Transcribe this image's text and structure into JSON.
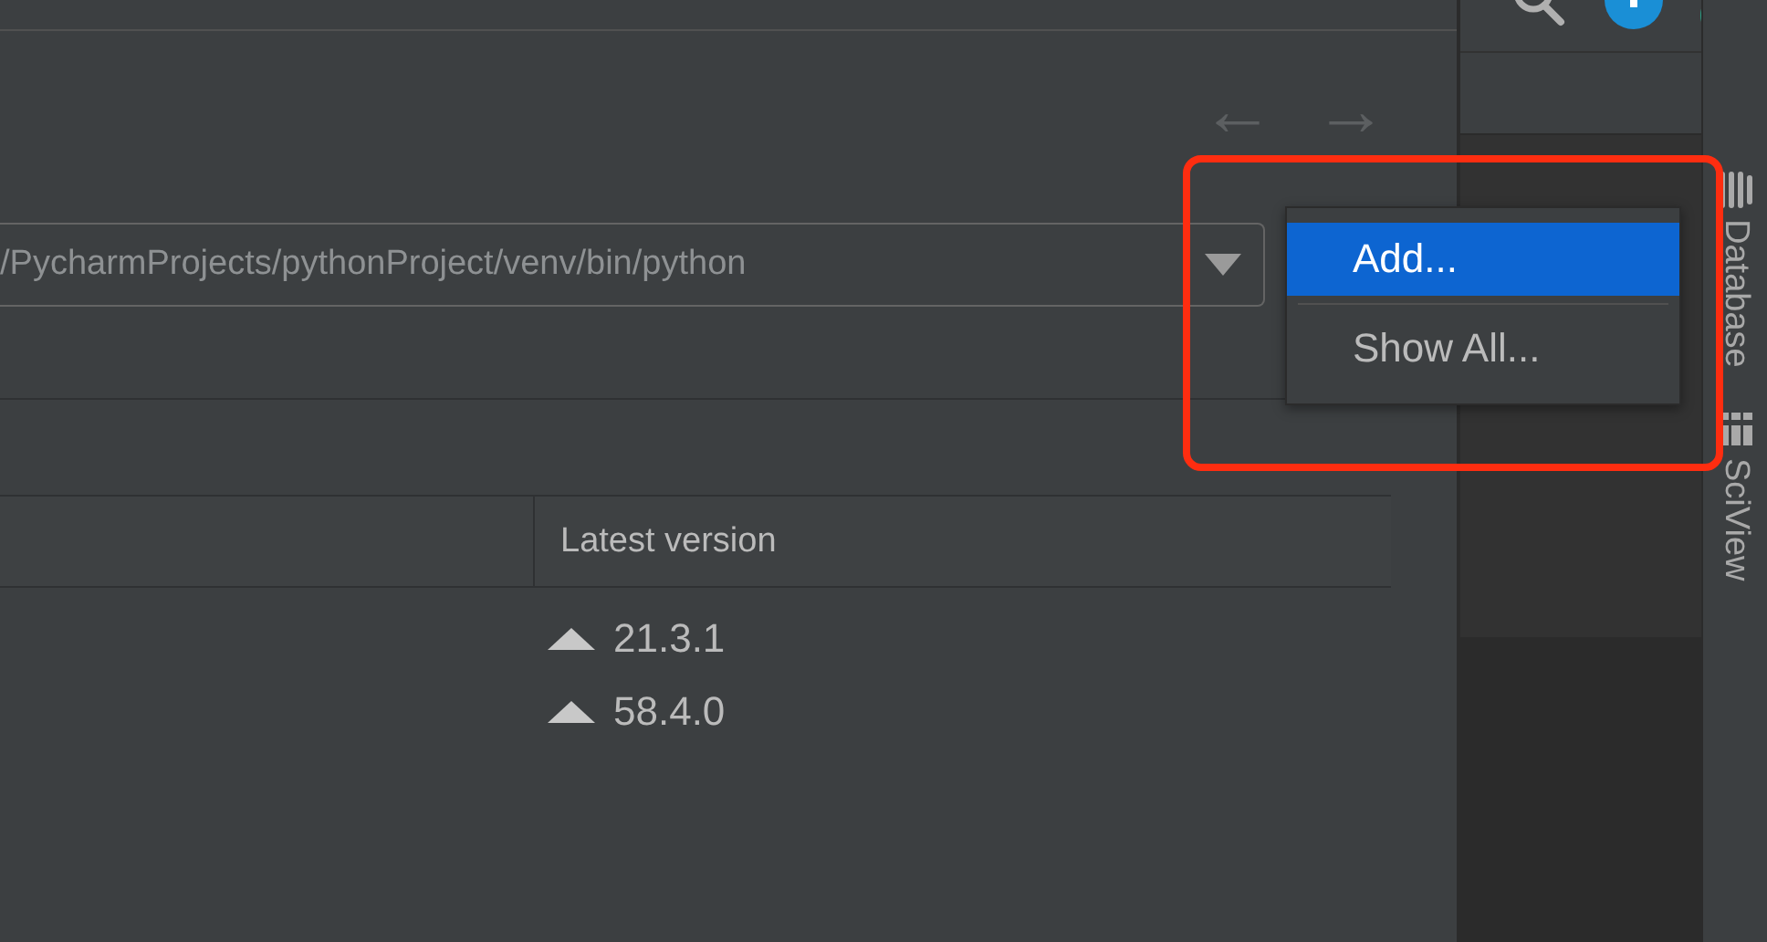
{
  "navigation": [
    {
      "symbol": "←",
      "disabled": true
    },
    {
      "symbol": "→",
      "disabled": true
    }
  ],
  "interpreter": {
    "value": "/PycharmProjects/pythonProject/venv/bin/python"
  },
  "popup_menu": {
    "items": [
      {
        "label": "Add...",
        "selected": true
      },
      {
        "label": "Show All...",
        "selected": false
      }
    ]
  },
  "packages_table": {
    "columns": [
      "Latest version"
    ],
    "rows": [
      {
        "latest_version": "21.3.1",
        "upgrade_available": true
      },
      {
        "latest_version": "58.4.0",
        "upgrade_available": true
      }
    ]
  },
  "tool_window_stripe": [
    {
      "label": "Database",
      "kind": "database"
    },
    {
      "label": "SciView",
      "kind": "sciview"
    }
  ]
}
